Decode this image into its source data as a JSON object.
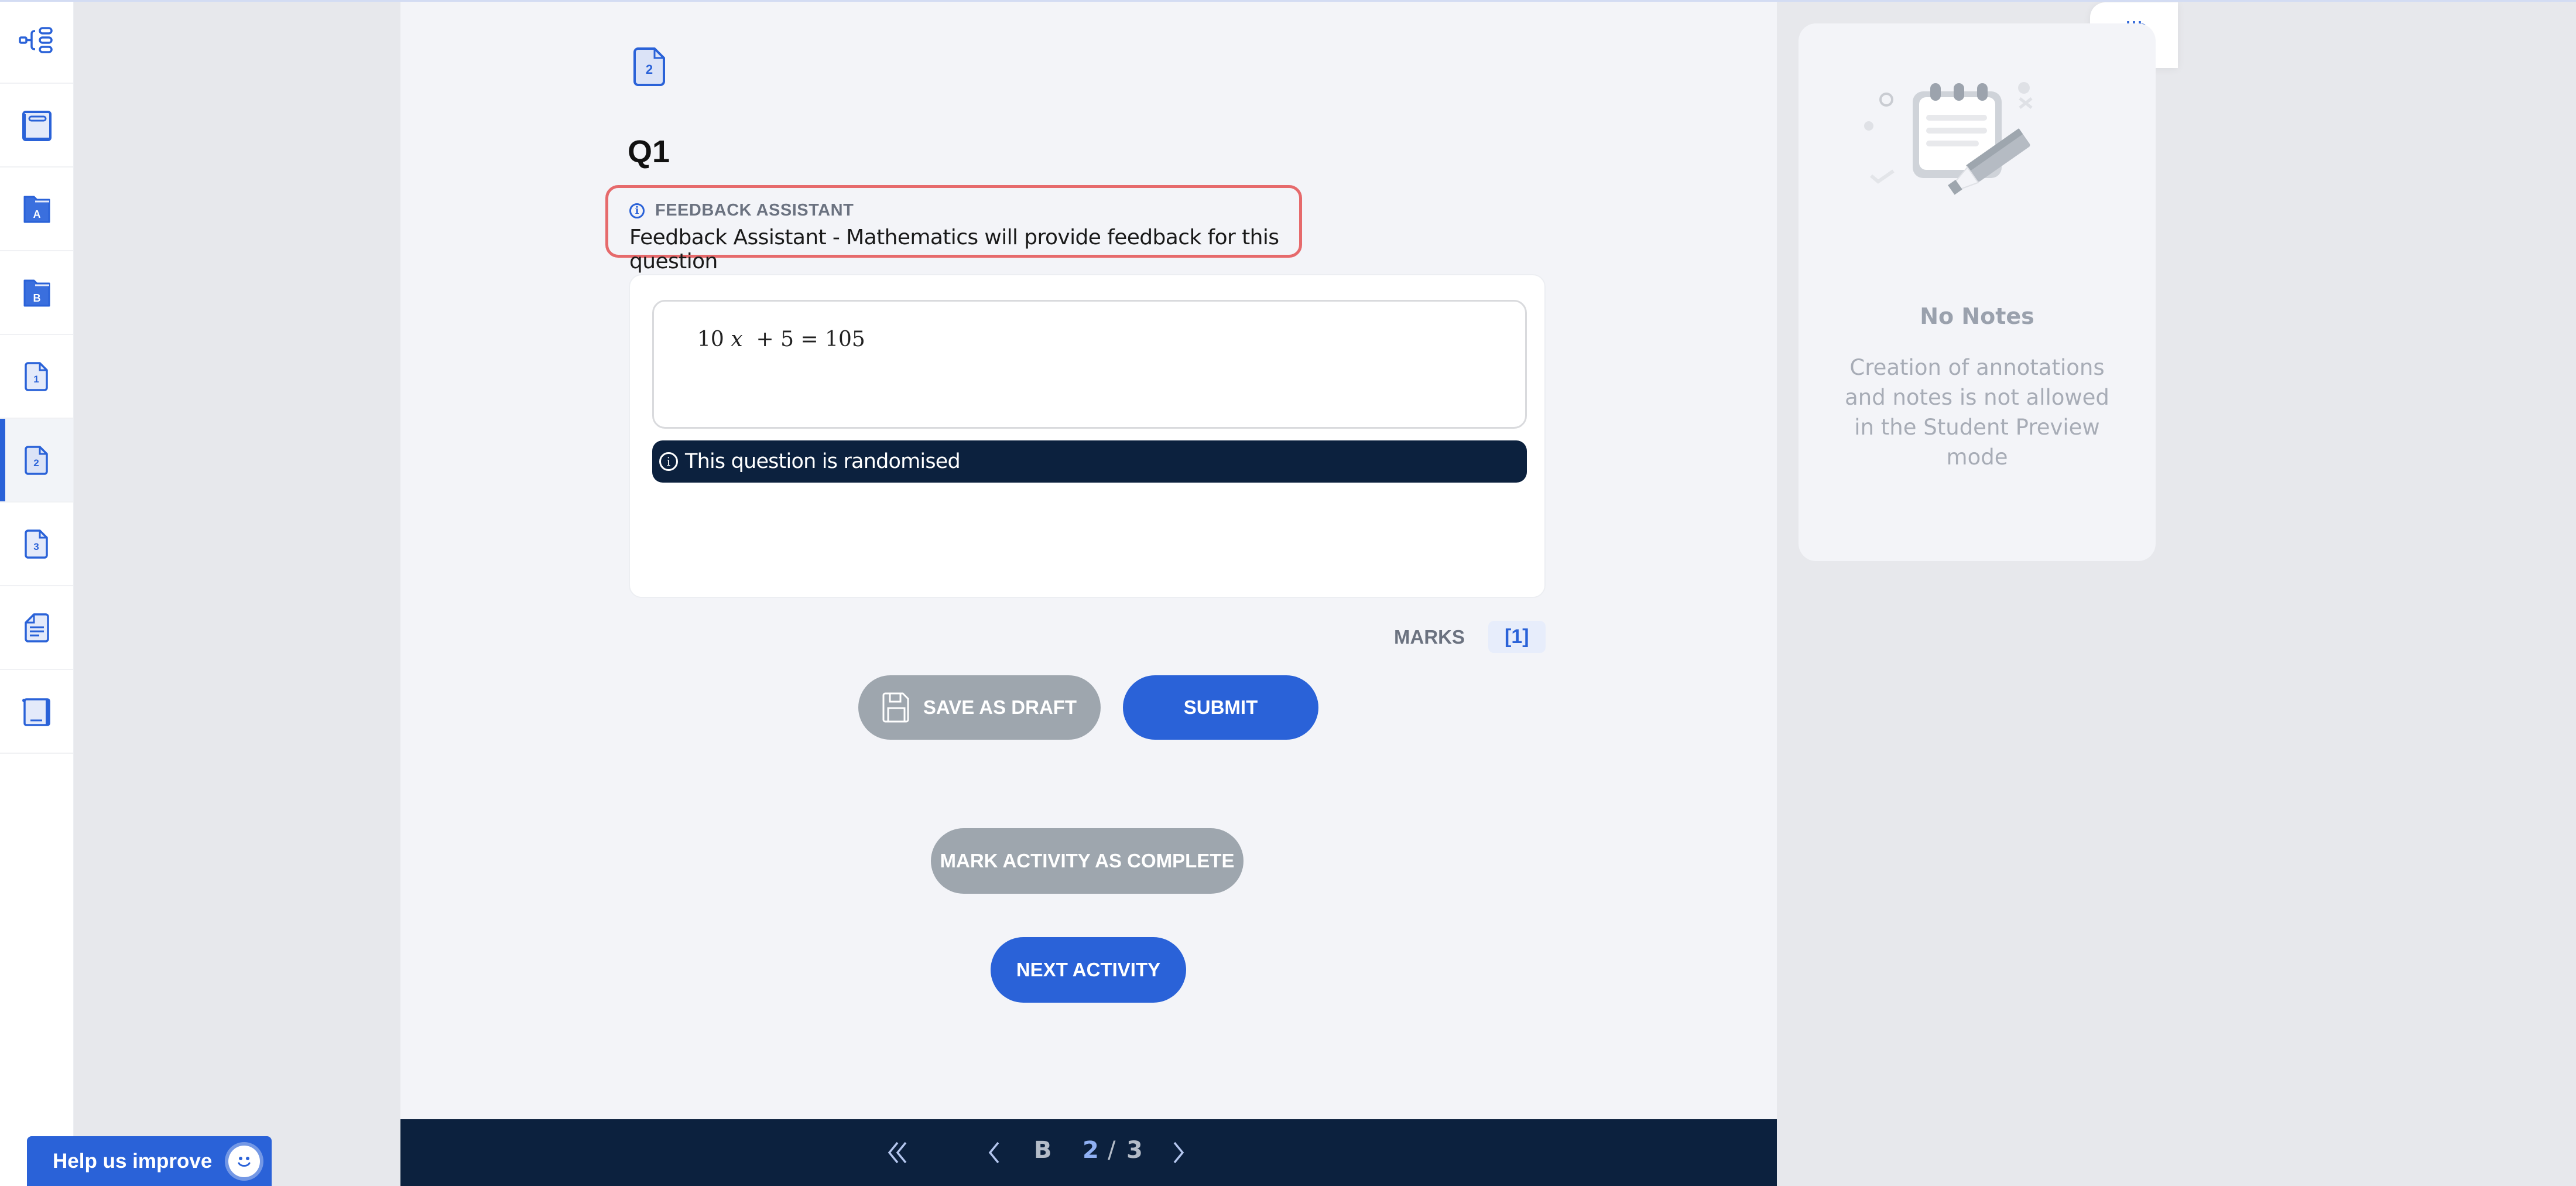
{
  "sidebar": {
    "items": [
      {
        "icon": "hierarchy-icon",
        "active": false
      },
      {
        "icon": "book-icon",
        "active": false
      },
      {
        "icon": "folder-a-icon",
        "label": "A",
        "active": false
      },
      {
        "icon": "folder-b-icon",
        "label": "B",
        "active": false
      },
      {
        "icon": "page-1-icon",
        "label": "1",
        "active": false
      },
      {
        "icon": "page-2-icon",
        "label": "2",
        "active": true
      },
      {
        "icon": "page-3-icon",
        "label": "3",
        "active": false
      },
      {
        "icon": "document-icon",
        "active": false
      },
      {
        "icon": "closed-book-icon",
        "active": false
      }
    ]
  },
  "main": {
    "page_icon_label": "2",
    "question_title": "Q1",
    "feedback_assistant": {
      "label": "FEEDBACK ASSISTANT",
      "text": "Feedback Assistant - Mathematics will provide feedback for this question"
    },
    "answer": {
      "coef": "10",
      "var": "x",
      "plus": "+",
      "const": "5",
      "eq": "=",
      "rhs": "105"
    },
    "randomised_notice": "This question is randomised",
    "marks_label": "MARKS",
    "marks_value": "[1]",
    "save_draft_label": "SAVE AS DRAFT",
    "submit_label": "SUBMIT",
    "mark_complete_label": "MARK ACTIVITY AS COMPLETE",
    "next_activity_label": "NEXT ACTIVITY"
  },
  "footer": {
    "section": "B",
    "current_page": "2",
    "separator": "/",
    "total_pages": "3"
  },
  "help": {
    "label": "Help us improve"
  },
  "notes": {
    "title": "No Notes",
    "description": "Creation of annotations and notes is not allowed in the Student Preview mode"
  },
  "colors": {
    "accent": "#2a62d8",
    "navy": "#0c213e",
    "alert_border": "#e66a6c",
    "disabled": "#9ea6ae"
  }
}
